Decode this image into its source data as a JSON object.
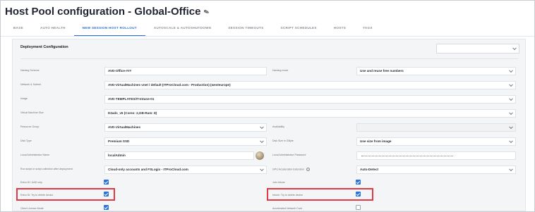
{
  "page": {
    "title": "Host Pool configuration - Global-Office",
    "edit_icon": "pencil-icon"
  },
  "tabs": [
    {
      "label": "BASE",
      "active": false
    },
    {
      "label": "AUTO HEALTH",
      "active": false
    },
    {
      "label": "NEW SESSION HOST ROLLOUT",
      "active": true
    },
    {
      "label": "AUTOSCALE & AUTOSHUTDOWN",
      "active": false
    },
    {
      "label": "SESSION TIMEOUTS",
      "active": false
    },
    {
      "label": "SCRIPT SCHEDULES",
      "active": false
    },
    {
      "label": "HOSTS",
      "active": false
    },
    {
      "label": "TAGS",
      "active": false
    }
  ],
  "section": {
    "title": "Deployment Configuration",
    "select_value": ""
  },
  "left": {
    "naming_scheme": {
      "label": "Naming Scheme",
      "value": "AVD-Office-###"
    },
    "network": {
      "label": "Network & Subnet",
      "value": "AVD-VirtualMachines vnet / default (ITProCloud.com - Production) (westeurope)"
    },
    "image": {
      "label": "Image",
      "value": "AVD-TEMPLATES/IT-Intune-01"
    },
    "vm_size": {
      "label": "Virtual Machine Size",
      "value": "D2ads_v5 (Cores: 2,GB-Ram: 8)"
    },
    "resource_group": {
      "label": "Resource Group",
      "value": "AVD-VirtualMachines"
    },
    "disk_type": {
      "label": "Disk Type",
      "value": "Premium SSD"
    },
    "admin_name": {
      "label": "Local Administrator Name",
      "value": "localAdmin"
    },
    "run_script": {
      "label": "Run script or script collection after deployment",
      "value": "Cloud-only accounts and FSLogix - ITProCloud.com"
    },
    "entra_only": {
      "label": "Entra ID / AAD only",
      "checked": true
    },
    "entra_delete": {
      "label": "Entra ID: Try to delete device",
      "checked": true
    },
    "client_license": {
      "label": "Client License Mode",
      "checked": true
    }
  },
  "right": {
    "naming_mode": {
      "label": "Naming mode",
      "value": "Use and reuse free numbers"
    },
    "availability": {
      "label": "Availability",
      "value": ""
    },
    "disk_size": {
      "label": "Disk Size in GByte",
      "value": "Use size from image"
    },
    "admin_password": {
      "label": "Local Administrator Password",
      "value": ""
    },
    "gpu": {
      "label": "GPU Acceleration Extension",
      "value": "Auto-Detect",
      "icon": "info-icon"
    },
    "join_intune": {
      "label": "Join Intune",
      "checked": true
    },
    "intune_delete": {
      "label": "Intune: Try to delete device",
      "checked": true
    },
    "accel_network": {
      "label": "Accelerated Network Card",
      "checked": false
    }
  },
  "colors": {
    "accent": "#2b6fd6",
    "highlight": "#e23a45",
    "checkbox": "#2b72d9"
  }
}
